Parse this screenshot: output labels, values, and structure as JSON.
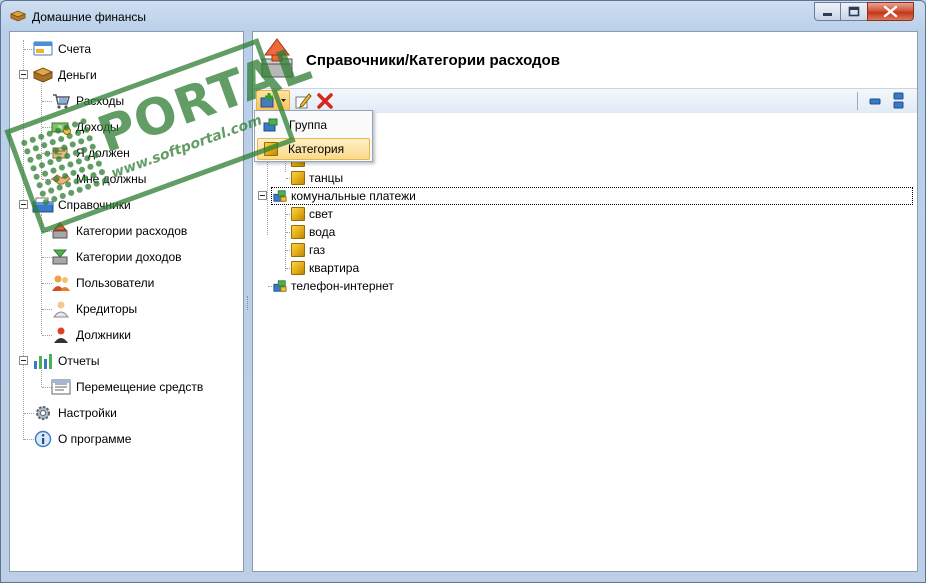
{
  "window": {
    "title": "Домашние финансы",
    "accent_color": "#bcd0e8",
    "minimize_icon": "minimize-icon",
    "maximize_icon": "maximize-icon",
    "close_icon": "close-icon"
  },
  "nav": {
    "items": [
      {
        "label": "Счета",
        "icon": "accounts-icon"
      },
      {
        "label": "Деньги",
        "icon": "wallet-icon",
        "expanded": true
      },
      {
        "label": "Расходы",
        "icon": "cart-icon"
      },
      {
        "label": "Доходы",
        "icon": "money-icon"
      },
      {
        "label": "Я должен",
        "icon": "debt-icon"
      },
      {
        "label": "Мне должны",
        "icon": "handshake-icon"
      },
      {
        "label": "Справочники",
        "icon": "books-icon",
        "expanded": true
      },
      {
        "label": "Категории расходов",
        "icon": "expense-categories-icon"
      },
      {
        "label": "Категории доходов",
        "icon": "income-categories-icon"
      },
      {
        "label": "Пользователи",
        "icon": "users-icon"
      },
      {
        "label": "Кредиторы",
        "icon": "creditors-icon"
      },
      {
        "label": "Должники",
        "icon": "debtors-icon"
      },
      {
        "label": "Отчеты",
        "icon": "reports-icon",
        "expanded": true
      },
      {
        "label": "Перемещение средств",
        "icon": "transfer-report-icon"
      },
      {
        "label": "Настройки",
        "icon": "gear-icon"
      },
      {
        "label": "О программе",
        "icon": "info-icon"
      }
    ]
  },
  "content": {
    "title": "Справочники/Категории расходов",
    "header_icon": "expense-categories-icon"
  },
  "toolbar": {
    "add_icon": "add-icon",
    "edit_icon": "edit-icon",
    "delete_icon": "delete-icon",
    "collapse_icon": "collapse-icon",
    "expand_icon": "expand-icon"
  },
  "dropdown": {
    "items": [
      {
        "label": "Группа",
        "icon": "group-icon"
      },
      {
        "label": "Категория",
        "icon": "category-box-icon",
        "highlighted": true
      }
    ]
  },
  "categories": {
    "items": [
      {
        "label": "танцы",
        "type": "category",
        "level": 1
      },
      {
        "label": "комунальные платежи",
        "type": "group",
        "level": 0,
        "selected": true
      },
      {
        "label": "свет",
        "type": "category",
        "level": 1
      },
      {
        "label": "вода",
        "type": "category",
        "level": 1
      },
      {
        "label": "газ",
        "type": "category",
        "level": 1
      },
      {
        "label": "квартира",
        "type": "category",
        "level": 1
      },
      {
        "label": "телефон-интернет",
        "type": "group",
        "level": 0
      }
    ]
  },
  "watermark": {
    "title": "PORTAL",
    "url": "www.softportal.com",
    "color": "#2e7d32"
  }
}
